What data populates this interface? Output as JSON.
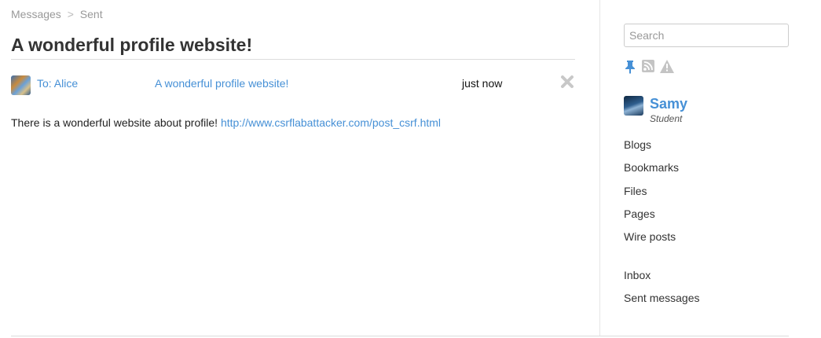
{
  "breadcrumb": {
    "parent": "Messages",
    "separator": ">",
    "current": "Sent"
  },
  "page": {
    "title": "A wonderful profile website!"
  },
  "message": {
    "to": "To: Alice",
    "subject": "A wonderful profile website!",
    "time": "just now",
    "body_text": "There is a wonderful website about profile! ",
    "body_link": "http://www.csrflabattacker.com/post_csrf.html",
    "avatar_icon": "user-avatar-icon",
    "delete_icon": "close-icon"
  },
  "sidebar": {
    "search_placeholder": "Search",
    "tool_icons": [
      "pin-icon",
      "rss-icon",
      "warning-icon"
    ],
    "owner": {
      "name": "Samy",
      "role": "Student"
    },
    "menu_primary": [
      "Blogs",
      "Bookmarks",
      "Files",
      "Pages",
      "Wire posts"
    ],
    "menu_secondary": [
      "Inbox",
      "Sent messages"
    ]
  },
  "colors": {
    "link": "#4690d6",
    "text": "#333333",
    "muted": "#999999",
    "border": "#dcdcdc"
  }
}
